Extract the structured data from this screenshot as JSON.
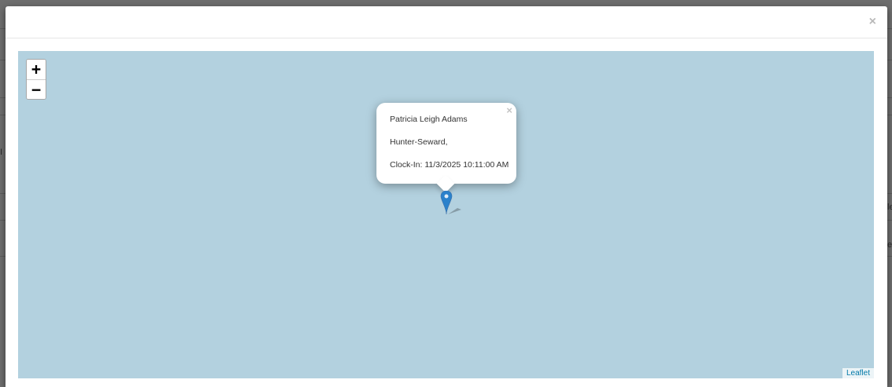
{
  "background": {
    "fragments": [
      "I",
      "le",
      "ea"
    ]
  },
  "modal": {
    "close_label": "×"
  },
  "map": {
    "zoom_in_label": "+",
    "zoom_out_label": "−",
    "attribution_label": "Leaflet",
    "water_color": "#b3d1df",
    "marker_color": "#2a81cb",
    "popup": {
      "close_label": "×",
      "lines": [
        "Patricia Leigh Adams",
        "Hunter-Seward,",
        "Clock-In: 11/3/2025 10:11:00 AM"
      ]
    }
  }
}
